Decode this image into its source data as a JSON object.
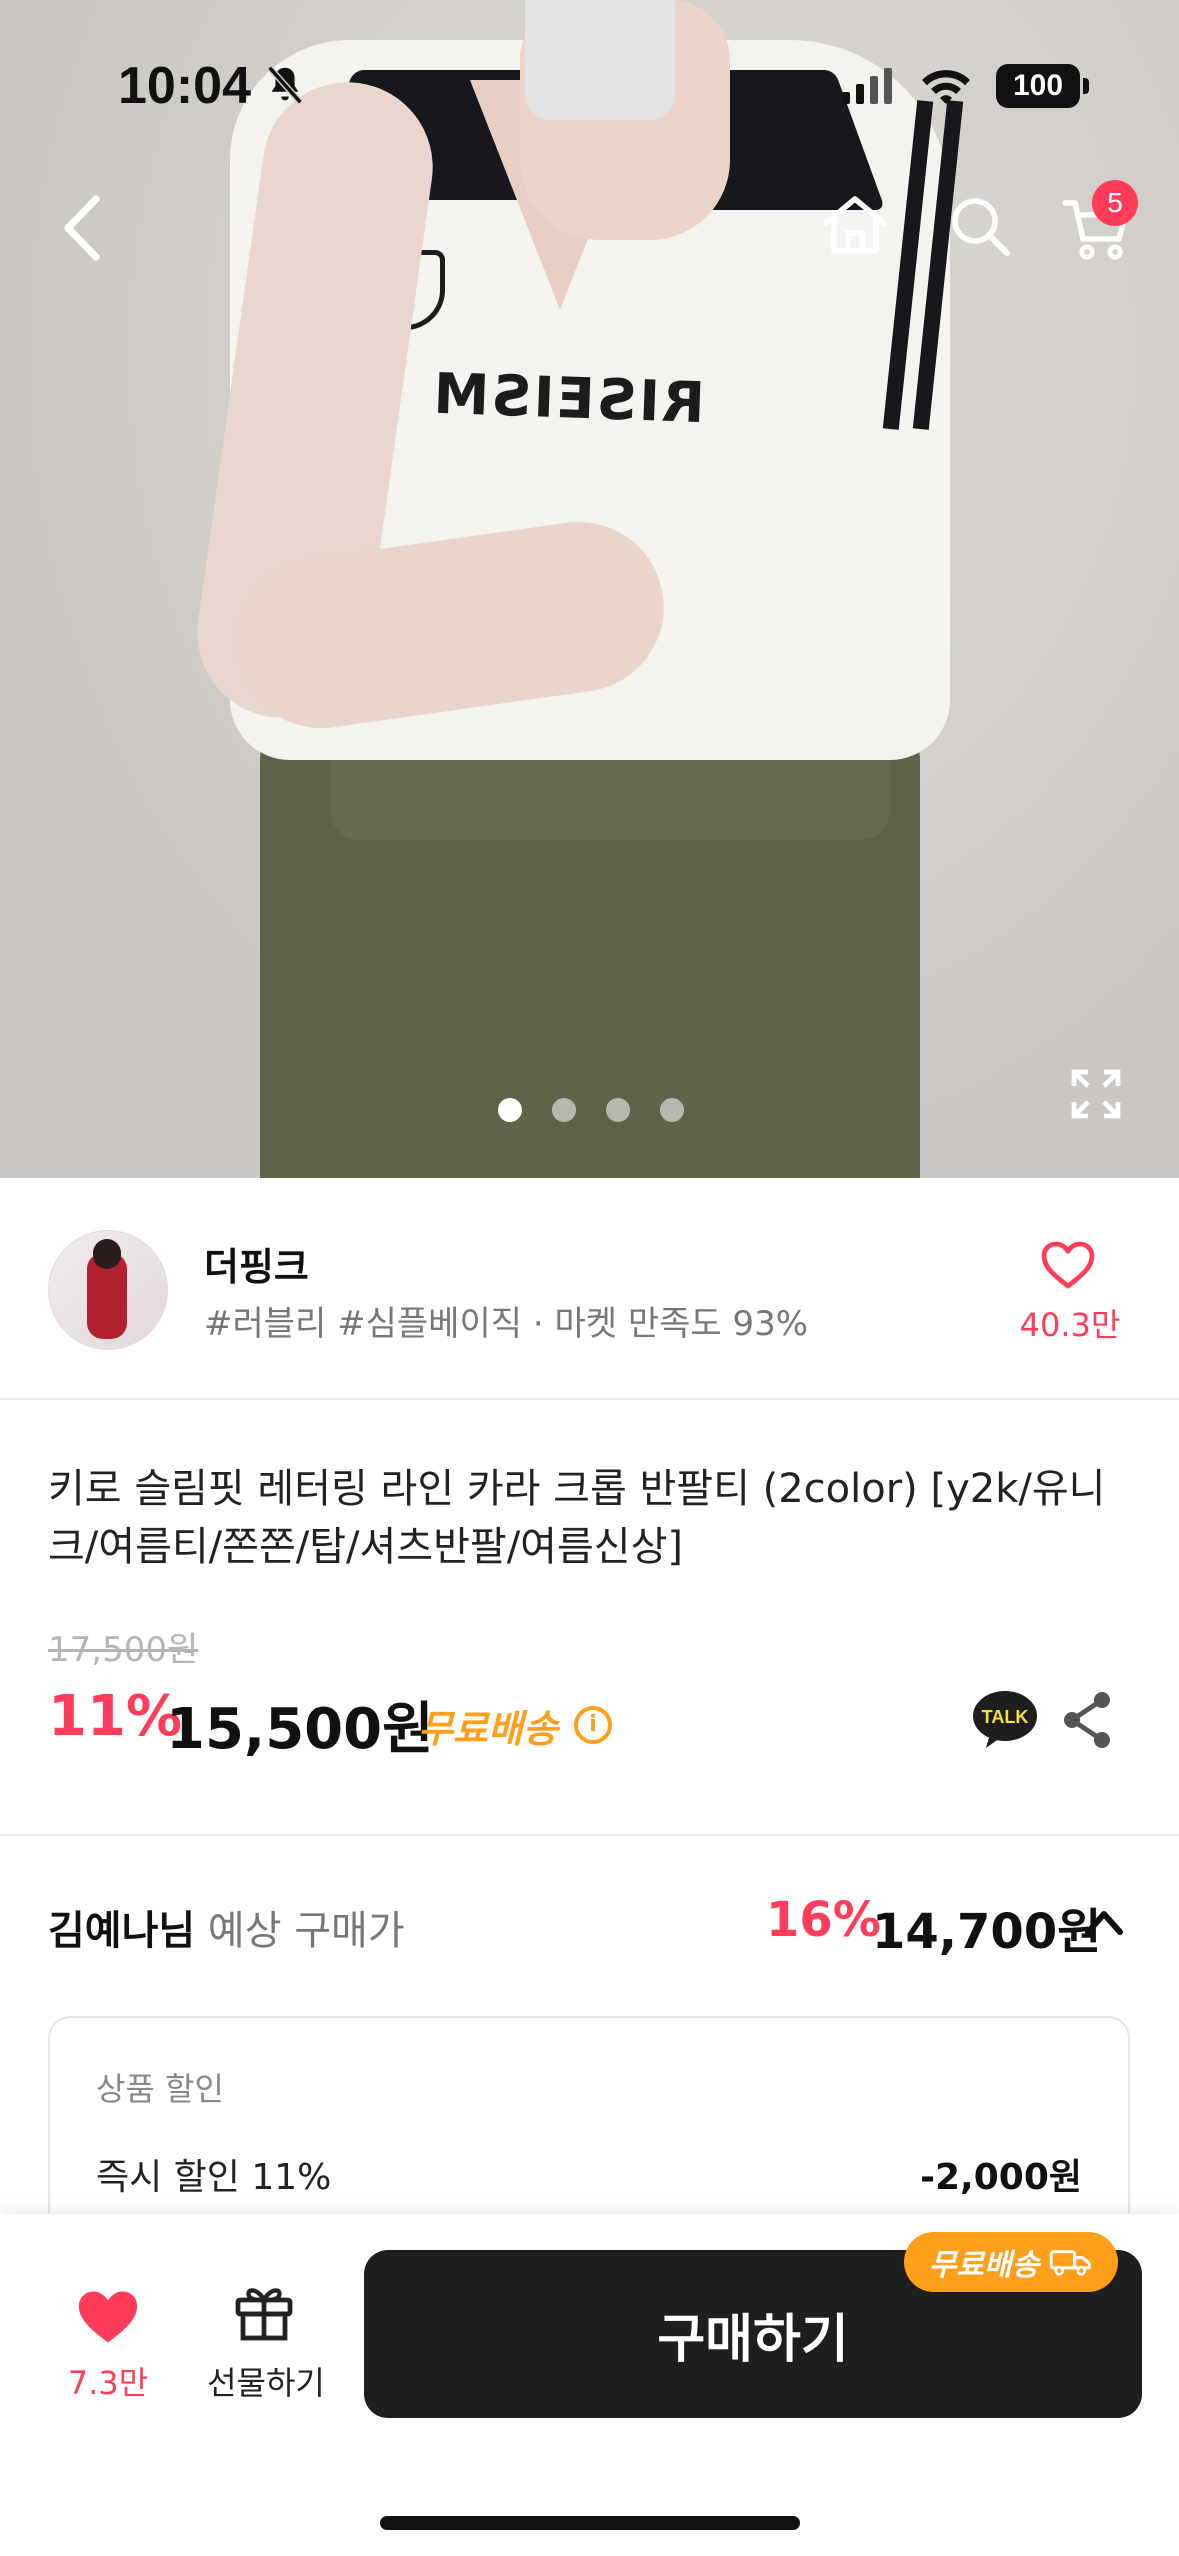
{
  "status_bar": {
    "time": "10:04",
    "battery": "100"
  },
  "nav": {
    "cart_count": "5",
    "icons": [
      "back-icon",
      "home-icon",
      "search-icon",
      "cart-icon"
    ]
  },
  "gallery": {
    "image_count": 4,
    "active_index": 0,
    "shirt_print": "RISEISM"
  },
  "store": {
    "name": "더핑크",
    "tags": "#러블리 #심플베이직 · 마켓 만족도 93%",
    "like_count": "40.3만"
  },
  "product": {
    "title": "키로 슬림핏 레터링 라인 카라 크롭 반팔티 (2color) [y2k/유니크/여름티/쫀쫀/탑/셔츠반팔/여름신상]",
    "original_price": "17,500원",
    "discount": "11%",
    "price": "15,500원",
    "free_shipping": "무료배송",
    "talk_label": "TALK"
  },
  "estimate": {
    "user": "김예나님",
    "label": "예상 구매가",
    "discount": "16%",
    "price": "14,700원"
  },
  "discount_card": {
    "header": "상품 할인",
    "row_label": "즉시 할인 11%",
    "row_value": "-2,000원"
  },
  "bottom_bar": {
    "like_count": "7.3만",
    "gift_label": "선물하기",
    "buy_label": "구매하기",
    "ship_pill": "무료배송"
  },
  "colors": {
    "accent_red": "#ff3d5a",
    "shipping_orange": "#ff9f1a",
    "button_dark": "#1e1e1e"
  }
}
